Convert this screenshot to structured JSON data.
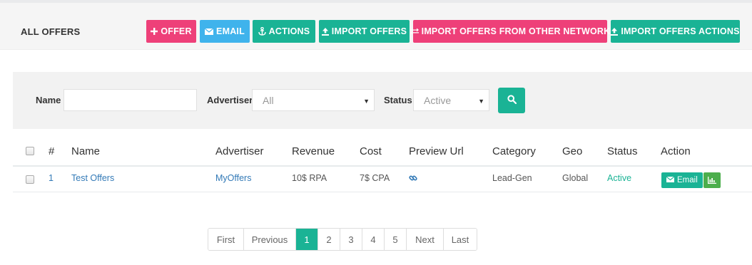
{
  "header": {
    "title": "ALL OFFERS",
    "buttons": {
      "offer": "OFFER",
      "email": "EMAIL",
      "actions": "ACTIONS",
      "import_offers": "IMPORT OFFERS",
      "import_other_network": "IMPORT OFFERS FROM OTHER NETWORK",
      "import_offers_actions": "IMPORT OFFERS ACTIONS"
    }
  },
  "filters": {
    "name_label": "Name",
    "name_value": "",
    "advertiser_label": "Advertiser",
    "advertiser_value": "All",
    "status_label": "Status",
    "status_value": "Active"
  },
  "table": {
    "columns": {
      "num": "#",
      "name": "Name",
      "advertiser": "Advertiser",
      "revenue": "Revenue",
      "cost": "Cost",
      "preview": "Preview Url",
      "category": "Category",
      "geo": "Geo",
      "status": "Status",
      "action": "Action"
    },
    "rows": [
      {
        "num": "1",
        "name": "Test Offers",
        "advertiser": "MyOffers",
        "revenue": "10$ RPA",
        "cost": "7$ CPA",
        "category": "Lead-Gen",
        "geo": "Global",
        "status": "Active",
        "email_label": "Email"
      }
    ]
  },
  "pagination": {
    "first": "First",
    "previous": "Previous",
    "pages": [
      "1",
      "2",
      "3",
      "4",
      "5"
    ],
    "current": "1",
    "next": "Next",
    "last": "Last"
  },
  "colors": {
    "pink": "#ee4079",
    "blue": "#3fb3ec",
    "teal": "#1ab395",
    "green": "#4cae4c",
    "link": "#337ab7"
  },
  "icons": [
    "plus-icon",
    "envelope-icon",
    "anchor-icon",
    "upload-icon",
    "exchange-icon",
    "search-icon",
    "link-icon",
    "bar-chart-icon",
    "caret-down-icon"
  ]
}
